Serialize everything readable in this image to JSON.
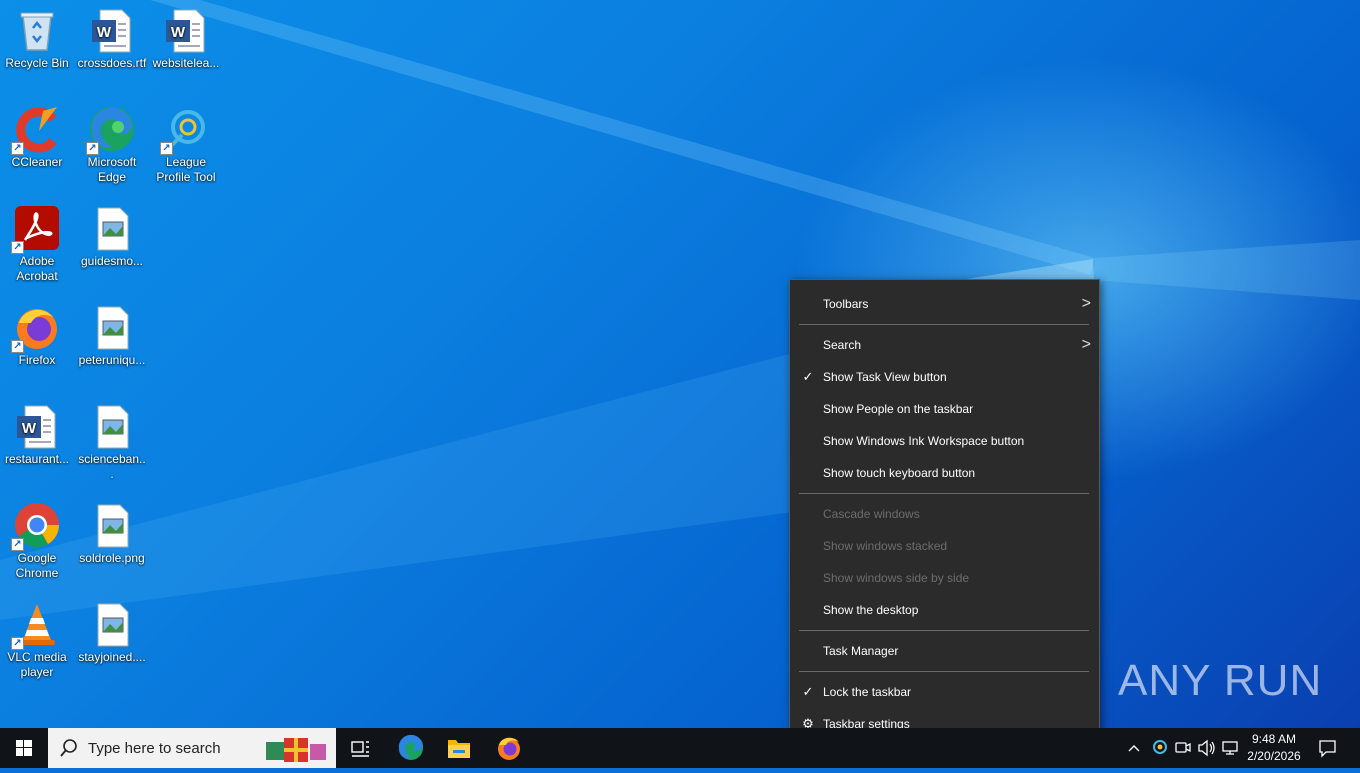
{
  "desktop_icons": [
    {
      "label": "Recycle Bin",
      "icon": "recycle-bin-icon"
    },
    {
      "label": "crossdoes.rtf",
      "icon": "word-document-icon"
    },
    {
      "label": "websitelea...",
      "icon": "word-document-icon"
    },
    {
      "label": "CCleaner",
      "icon": "ccleaner-icon"
    },
    {
      "label": "Microsoft Edge",
      "icon": "edge-icon"
    },
    {
      "label": "League Profile Tool",
      "icon": "league-profile-tool-icon"
    },
    {
      "label": "Adobe Acrobat",
      "icon": "adobe-acrobat-icon"
    },
    {
      "label": "guidesmo...",
      "icon": "image-file-icon"
    },
    {
      "label": "Firefox",
      "icon": "firefox-icon"
    },
    {
      "label": "peteruniqu...",
      "icon": "image-file-icon"
    },
    {
      "label": "restaurant...",
      "icon": "word-document-icon"
    },
    {
      "label": "scienceban...",
      "icon": "image-file-icon"
    },
    {
      "label": "Google Chrome",
      "icon": "chrome-icon"
    },
    {
      "label": "soldrole.png",
      "icon": "image-file-icon"
    },
    {
      "label": "VLC media player",
      "icon": "vlc-icon"
    },
    {
      "label": "stayjoined....",
      "icon": "image-file-icon"
    }
  ],
  "context_menu": {
    "items": [
      {
        "label": "Toolbars",
        "submenu": true
      },
      {
        "label": "Search",
        "submenu": true
      },
      {
        "label": "Show Task View button",
        "checked": true
      },
      {
        "label": "Show People on the taskbar"
      },
      {
        "label": "Show Windows Ink Workspace button"
      },
      {
        "label": "Show touch keyboard button"
      },
      {
        "label": "Cascade windows",
        "disabled": true
      },
      {
        "label": "Show windows stacked",
        "disabled": true
      },
      {
        "label": "Show windows side by side",
        "disabled": true
      },
      {
        "label": "Show the desktop"
      },
      {
        "label": "Task Manager"
      },
      {
        "label": "Lock the taskbar",
        "checked": true
      },
      {
        "label": "Taskbar settings",
        "icon": "gear-icon"
      }
    ]
  },
  "taskbar": {
    "search_placeholder": "Type here to search",
    "apps": [
      "task-view-icon",
      "edge-icon",
      "file-explorer-icon",
      "firefox-icon"
    ],
    "clock_time": "9:48 AM",
    "clock_date": "2/20/2026"
  },
  "watermark": "ANY RUN",
  "colors": {
    "menu_bg": "#2b2b2b",
    "taskbar_bg": "#101418",
    "desktop_blue": "#0b7fe0"
  }
}
